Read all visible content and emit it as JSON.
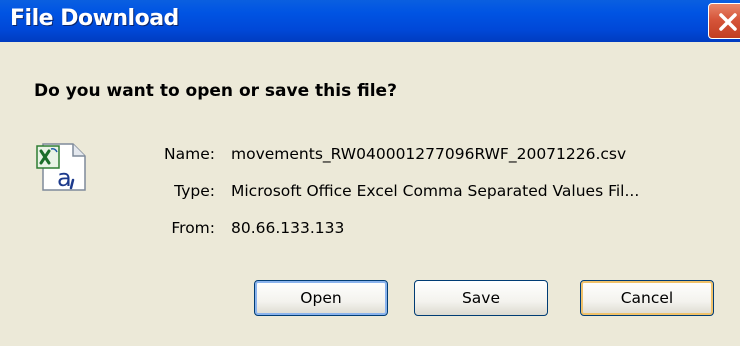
{
  "window": {
    "title": "File Download"
  },
  "dialog": {
    "question": "Do you want to open or save this file?",
    "file_icon": "excel-csv-file-icon",
    "fields": [
      {
        "label": "Name:",
        "value": "movements_RW040001277096RWF_20071226.csv"
      },
      {
        "label": "Type:",
        "value": "Microsoft Office Excel Comma Separated Values Fil..."
      },
      {
        "label": "From:",
        "value": "80.66.133.133"
      }
    ]
  },
  "buttons": {
    "open": "Open",
    "save": "Save",
    "cancel": "Cancel"
  },
  "colors": {
    "titlebar": "#0054e3",
    "dialog_bg": "#ece9d8",
    "close_button": "#d6553a",
    "button_border": "#003c74"
  }
}
